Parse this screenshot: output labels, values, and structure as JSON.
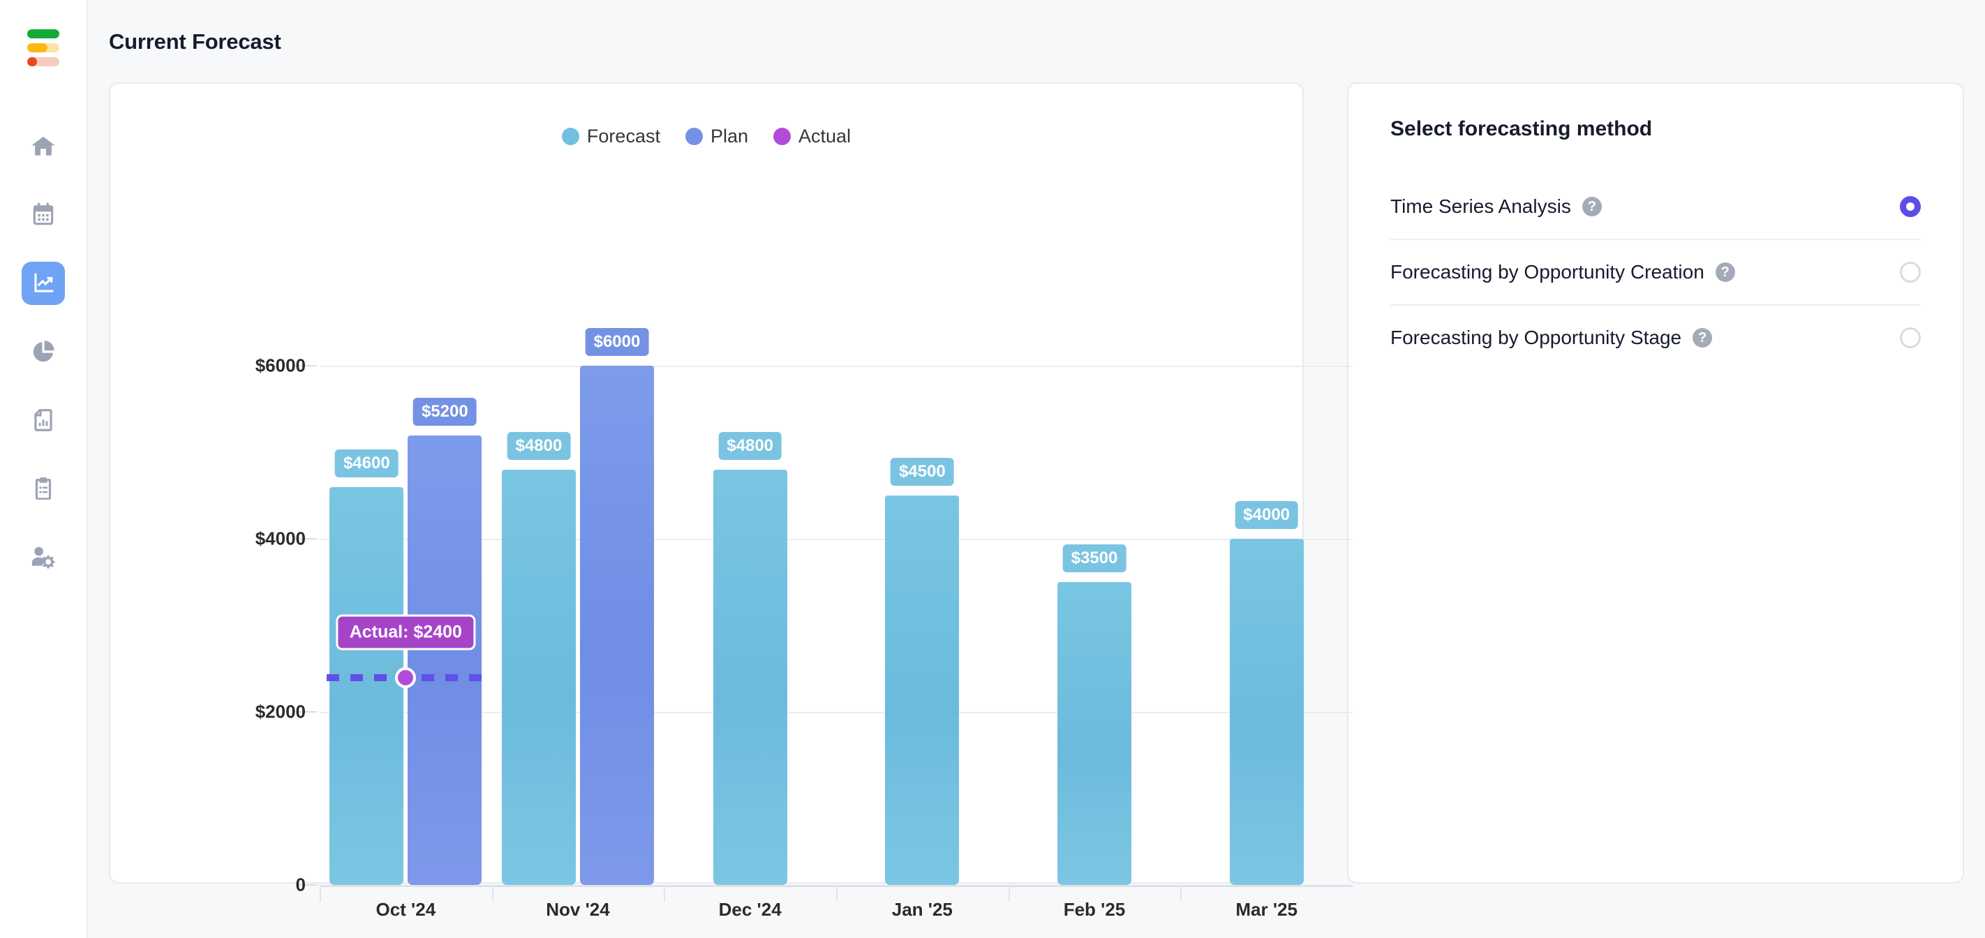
{
  "app": {
    "logo_name": "app-logo"
  },
  "sidebar": {
    "items": [
      {
        "name": "home",
        "label": "Home",
        "icon": "home-icon",
        "active": false
      },
      {
        "name": "calendar",
        "label": "Calendar",
        "icon": "calendar-icon",
        "active": false
      },
      {
        "name": "forecast",
        "label": "Forecast",
        "icon": "line-chart-icon",
        "active": true
      },
      {
        "name": "analytics",
        "label": "Analytics",
        "icon": "pie-chart-icon",
        "active": false
      },
      {
        "name": "reports",
        "label": "Reports",
        "icon": "report-document-icon",
        "active": false
      },
      {
        "name": "tasks",
        "label": "Tasks",
        "icon": "clipboard-list-icon",
        "active": false
      },
      {
        "name": "admin",
        "label": "Admin",
        "icon": "user-settings-icon",
        "active": false
      }
    ]
  },
  "header": {
    "title": "Current Forecast"
  },
  "chart_data": {
    "type": "bar",
    "title": "Current Forecast",
    "xlabel": "",
    "ylabel": "",
    "ylim": [
      0,
      6600
    ],
    "grid": true,
    "legend_position": "top-center",
    "ytick_labels": [
      "$6000",
      "$4000",
      "$2000",
      "0"
    ],
    "ytick_values": [
      6000,
      4000,
      2000,
      0
    ],
    "categories": [
      "Oct '24",
      "Nov '24",
      "Dec '24",
      "Jan '25",
      "Feb '25",
      "Mar '25"
    ],
    "series": [
      {
        "name": "Forecast",
        "color": "#72C0DF",
        "values": [
          4600,
          4800,
          4800,
          4500,
          3500,
          4000
        ],
        "labels": [
          "$4600",
          "$4800",
          "$4800",
          "$4500",
          "$3500",
          "$4000"
        ]
      },
      {
        "name": "Plan",
        "color": "#7491E4",
        "values": [
          5200,
          6000,
          null,
          null,
          null,
          null
        ],
        "labels": [
          "$5200",
          "$6000",
          "",
          "",
          "",
          ""
        ]
      },
      {
        "name": "Actual",
        "color": "#B24CD8",
        "values": [
          2400,
          null,
          null,
          null,
          null,
          null
        ],
        "labels": [
          "Actual: $2400",
          "",
          "",
          "",
          "",
          ""
        ]
      }
    ],
    "annotations": [
      {
        "text": "Actual: $2400",
        "category": "Oct '24",
        "value": 2400,
        "style": "tooltip"
      }
    ]
  },
  "method_panel": {
    "title": "Select forecasting method",
    "help_glyph": "?",
    "options": [
      {
        "label": "Time Series Analysis",
        "selected": true
      },
      {
        "label": "Forecasting by Opportunity Creation",
        "selected": false
      },
      {
        "label": "Forecasting by Opportunity Stage",
        "selected": false
      }
    ]
  },
  "colors": {
    "page_background": "#F7F8FA",
    "card_background": "#FFFFFF",
    "accent_active_nav": "#6FA3F5",
    "radio_selected": "#5B4DE8",
    "forecast": "#72C0DF",
    "plan": "#7491E4",
    "actual": "#B24CD8",
    "actual_line": "#6050E8"
  }
}
